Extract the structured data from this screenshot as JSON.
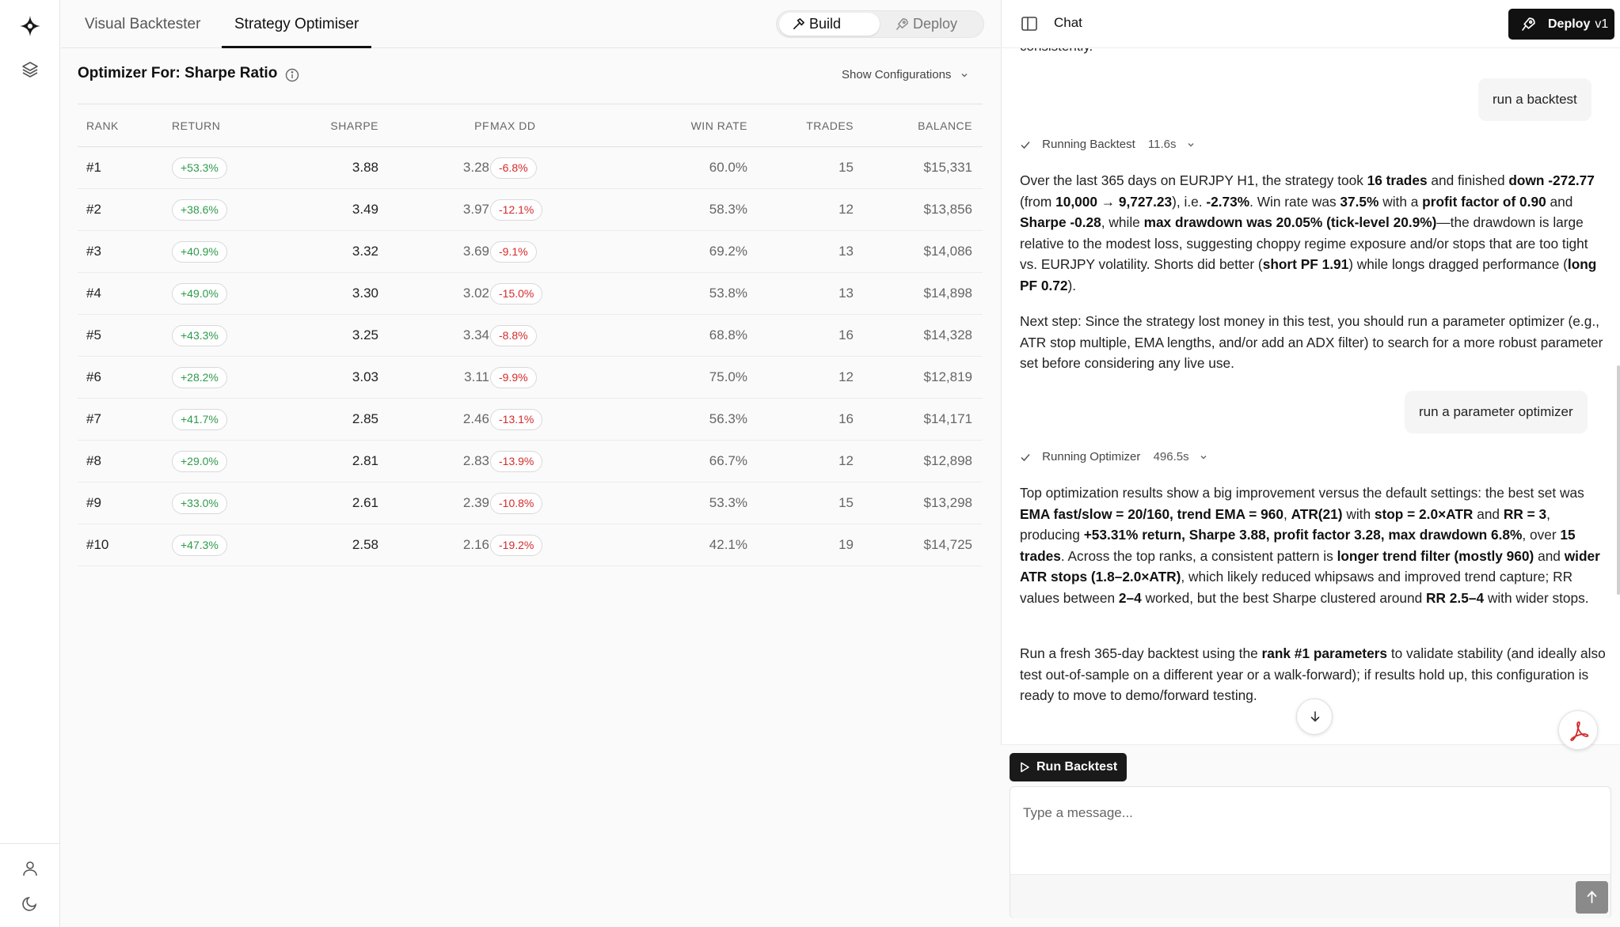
{
  "tabs": [
    {
      "label": "Visual Backtester"
    },
    {
      "label": "Strategy Optimiser"
    }
  ],
  "mode": {
    "build": "Build",
    "deploy": "Deploy"
  },
  "optimizer": {
    "title": "Optimizer For: Sharpe Ratio",
    "show_configurations": "Show Configurations"
  },
  "table": {
    "headers": [
      "RANK",
      "RETURN",
      "SHARPE",
      "PF",
      "MAX DD",
      "WIN RATE",
      "TRADES",
      "BALANCE"
    ],
    "rows": [
      {
        "rank": "#1",
        "return": "+53.3%",
        "sharpe": "3.88",
        "pf": "3.28",
        "dd": "-6.8%",
        "win": "60.0%",
        "trades": "15",
        "balance": "$15,331"
      },
      {
        "rank": "#2",
        "return": "+38.6%",
        "sharpe": "3.49",
        "pf": "3.97",
        "dd": "-12.1%",
        "win": "58.3%",
        "trades": "12",
        "balance": "$13,856"
      },
      {
        "rank": "#3",
        "return": "+40.9%",
        "sharpe": "3.32",
        "pf": "3.69",
        "dd": "-9.1%",
        "win": "69.2%",
        "trades": "13",
        "balance": "$14,086"
      },
      {
        "rank": "#4",
        "return": "+49.0%",
        "sharpe": "3.30",
        "pf": "3.02",
        "dd": "-15.0%",
        "win": "53.8%",
        "trades": "13",
        "balance": "$14,898"
      },
      {
        "rank": "#5",
        "return": "+43.3%",
        "sharpe": "3.25",
        "pf": "3.34",
        "dd": "-8.8%",
        "win": "68.8%",
        "trades": "16",
        "balance": "$14,328"
      },
      {
        "rank": "#6",
        "return": "+28.2%",
        "sharpe": "3.03",
        "pf": "3.11",
        "dd": "-9.9%",
        "win": "75.0%",
        "trades": "12",
        "balance": "$12,819"
      },
      {
        "rank": "#7",
        "return": "+41.7%",
        "sharpe": "2.85",
        "pf": "2.46",
        "dd": "-13.1%",
        "win": "56.3%",
        "trades": "16",
        "balance": "$14,171"
      },
      {
        "rank": "#8",
        "return": "+29.0%",
        "sharpe": "2.81",
        "pf": "2.83",
        "dd": "-13.9%",
        "win": "66.7%",
        "trades": "12",
        "balance": "$12,898"
      },
      {
        "rank": "#9",
        "return": "+33.0%",
        "sharpe": "2.61",
        "pf": "2.39",
        "dd": "-10.8%",
        "win": "53.3%",
        "trades": "15",
        "balance": "$13,298"
      },
      {
        "rank": "#10",
        "return": "+47.3%",
        "sharpe": "2.58",
        "pf": "2.16",
        "dd": "-19.2%",
        "win": "42.1%",
        "trades": "19",
        "balance": "$14,725"
      }
    ]
  },
  "chat": {
    "title": "Chat",
    "deploy_label": "Deploy",
    "deploy_version": "v1",
    "cut_text": "consistently.",
    "user_msg_1": "run a backtest",
    "status_1": {
      "label": "Running Backtest",
      "duration": "11.6s"
    },
    "user_msg_2": "run a parameter optimizer",
    "status_2": {
      "label": "Running Optimizer",
      "duration": "496.5s"
    },
    "p1": [
      {
        "t": "Over the last 365 days on EURJPY H1, the strategy took "
      },
      {
        "b": "16 trades"
      },
      {
        "t": " and finished "
      },
      {
        "b": "down -272.77"
      },
      {
        "t": " (from "
      },
      {
        "b": "10,000 → 9,727.23"
      },
      {
        "t": "), i.e. "
      },
      {
        "b": "-2.73%"
      },
      {
        "t": ". Win rate was "
      },
      {
        "b": "37.5%"
      },
      {
        "t": " with a "
      },
      {
        "b": "profit factor of 0.90"
      },
      {
        "t": " and "
      },
      {
        "b": "Sharpe -0.28"
      },
      {
        "t": ", while "
      },
      {
        "b": "max drawdown was 20.05% (tick-level 20.9%)"
      },
      {
        "t": "—the drawdown is large relative to the modest loss, suggesting choppy regime exposure and/or stops that are too tight vs. EURJPY volatility. Shorts did better ("
      },
      {
        "b": "short PF 1.91"
      },
      {
        "t": ") while longs dragged performance ("
      },
      {
        "b": "long PF 0.72"
      },
      {
        "t": ")."
      }
    ],
    "p2": [
      {
        "t": "Next step: Since the strategy lost money in this test, you should run a parameter optimizer (e.g., ATR stop multiple, EMA lengths, and/or add an ADX filter) to search for a more robust parameter set before considering any live use."
      }
    ],
    "p3": [
      {
        "t": "Top optimization results show a big improvement versus the default settings: the best set was "
      },
      {
        "b": "EMA fast/slow = 20/160, trend EMA = 960"
      },
      {
        "t": ", "
      },
      {
        "b": "ATR(21)"
      },
      {
        "t": " with "
      },
      {
        "b": "stop = 2.0×ATR"
      },
      {
        "t": " and "
      },
      {
        "b": "RR = 3"
      },
      {
        "t": ", producing "
      },
      {
        "b": "+53.31% return, Sharpe 3.88, profit factor 3.28, max drawdown 6.8%"
      },
      {
        "t": ", over "
      },
      {
        "b": "15 trades"
      },
      {
        "t": ". Across the top ranks, a consistent pattern is "
      },
      {
        "b": "longer trend filter (mostly 960)"
      },
      {
        "t": " and "
      },
      {
        "b": "wider ATR stops (1.8–2.0×ATR)"
      },
      {
        "t": ", which likely reduced whipsaws and improved trend capture; RR values between "
      },
      {
        "b": "2–4"
      },
      {
        "t": " worked, but the best Sharpe clustered around "
      },
      {
        "b": "RR 2.5–4"
      },
      {
        "t": " with wider stops."
      }
    ],
    "p4": [
      {
        "t": "Run a fresh 365-day backtest using the "
      },
      {
        "b": "rank #1 parameters"
      },
      {
        "t": " to validate stability (and ideally also test out-of-sample on a different year or a walk-forward); if results hold up, this configuration is ready to move to demo/forward testing."
      }
    ],
    "run_backtest": "Run Backtest",
    "input_placeholder": "Type a message..."
  }
}
